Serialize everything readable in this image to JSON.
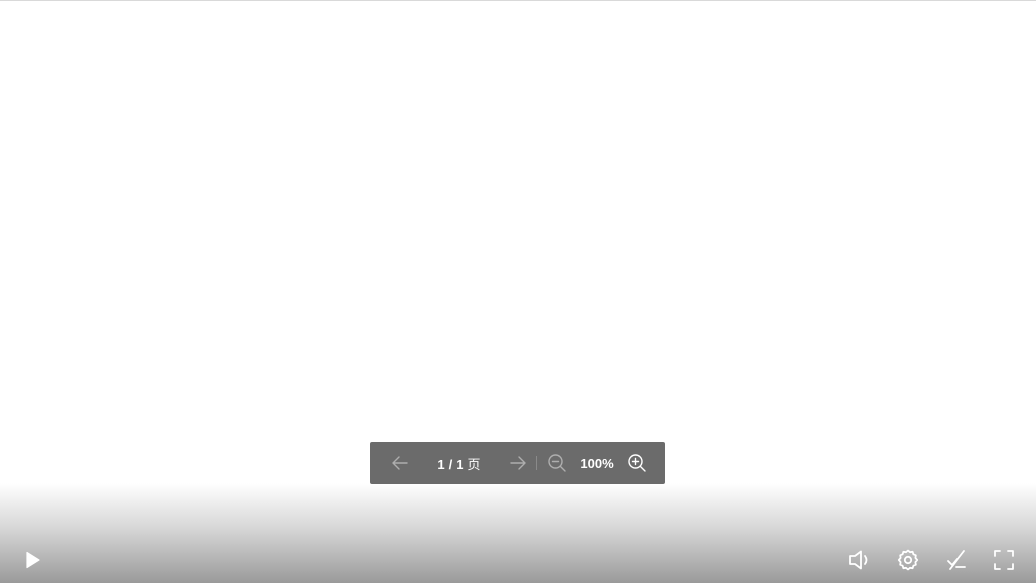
{
  "toolbar": {
    "page_current": "1",
    "page_sep": " / ",
    "page_total": "1",
    "page_unit": " 页",
    "zoom": "100%",
    "prev_icon": "arrow-left-icon",
    "next_icon": "arrow-right-icon",
    "zoom_out_icon": "zoom-out-icon",
    "zoom_in_icon": "zoom-in-icon"
  },
  "controls": {
    "play_icon": "play-icon",
    "volume_icon": "volume-icon",
    "settings_icon": "gear-icon",
    "annotation_icon": "annotation-off-icon",
    "fullscreen_icon": "fullscreen-icon"
  },
  "colors": {
    "toolbar_bg": "#6b6b6b",
    "icon_white": "#ffffff"
  }
}
